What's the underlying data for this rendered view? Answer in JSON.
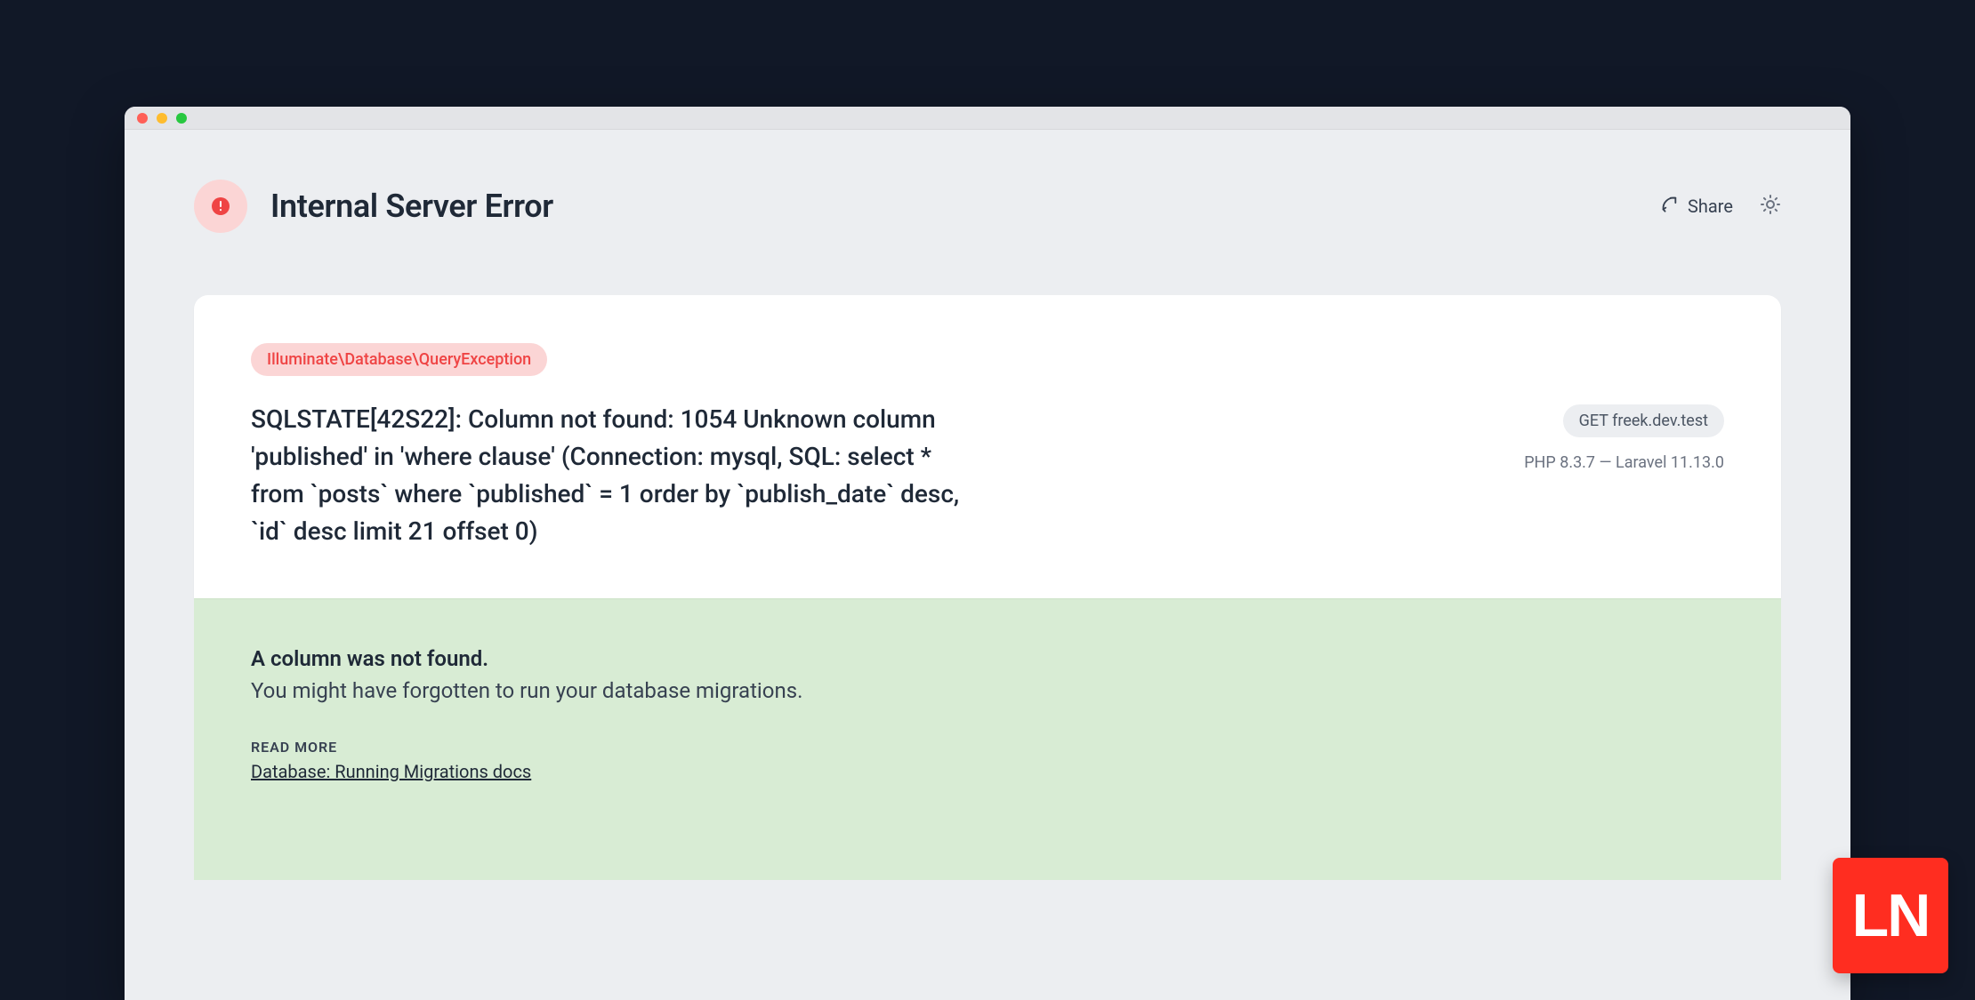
{
  "window": {
    "traffic_light_colors": {
      "close": "#ff5f57",
      "minimize": "#febc2e",
      "zoom": "#28c840"
    }
  },
  "header": {
    "title": "Internal Server Error",
    "share_label": "Share"
  },
  "exception": {
    "class": "Illuminate\\Database\\QueryException",
    "message": "SQLSTATE[42S22]: Column not found: 1054 Unknown column 'published' in 'where clause' (Connection: mysql, SQL: select * from `posts` where `published` = 1 order by `publish_date` desc, `id` desc limit 21 offset 0)",
    "route_badge": "GET freek.dev.test",
    "env_line": "PHP 8.3.7 — Laravel 11.13.0"
  },
  "hint": {
    "title": "A column was not found.",
    "body": "You might have forgotten to run your database migrations.",
    "read_more_label": "READ MORE",
    "doc_link_label": "Database: Running Migrations docs"
  },
  "brand_badge": {
    "text": "LN",
    "bg": "#ff2d20"
  }
}
